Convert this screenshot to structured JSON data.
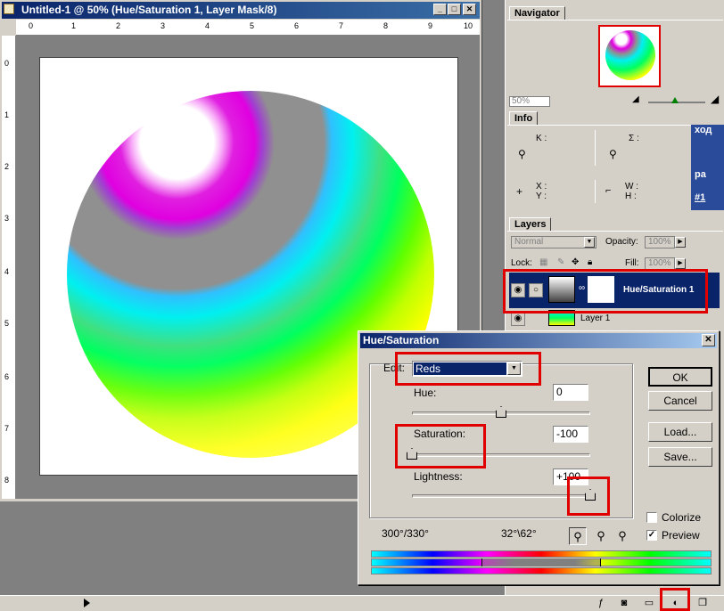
{
  "document": {
    "title": "Untitled-1 @ 50% (Hue/Saturation 1, Layer Mask/8)",
    "ruler_top_ticks": [
      "0",
      "1",
      "2",
      "3",
      "4",
      "5",
      "6",
      "7",
      "8",
      "9",
      "10"
    ],
    "ruler_left_ticks": [
      "0",
      "1",
      "2",
      "3",
      "4",
      "5",
      "6",
      "7",
      "8"
    ],
    "minimize": "_",
    "maximize": "□",
    "close": "✕"
  },
  "navigator": {
    "tab": "Navigator",
    "zoom": "50%"
  },
  "info": {
    "tab": "Info",
    "k_label": "K :",
    "sigma_label": "Σ :",
    "x_label": "X :",
    "y_label": "Y :",
    "w_label": "W :",
    "h_label": "H :",
    "blue_strip_top": "ход",
    "blue_strip_mid": "ра",
    "blue_strip_bot": "#1"
  },
  "layers": {
    "tab": "Layers",
    "blend_mode": "Normal",
    "opacity_label": "Opacity:",
    "opacity_value": "100%",
    "lock_label": "Lock:",
    "fill_label": "Fill:",
    "fill_value": "100%",
    "rows": [
      {
        "name": "Hue/Saturation 1"
      },
      {
        "name": "Layer 1"
      }
    ]
  },
  "dialog": {
    "title": "Hue/Saturation",
    "close": "✕",
    "edit_label": "Edit:",
    "edit_value": "Reds",
    "hue_label": "Hue:",
    "hue_value": "0",
    "saturation_label": "Saturation:",
    "saturation_value": "-100",
    "lightness_label": "Lightness:",
    "lightness_value": "+100",
    "hue_level": 0.5,
    "saturation_level": 0.0,
    "lightness_level": 1.0,
    "range_left": "300°/330°",
    "range_right": "32°\\62°",
    "buttons": {
      "ok": "OK",
      "cancel": "Cancel",
      "load": "Load...",
      "save": "Save..."
    },
    "colorize_label": "Colorize",
    "preview_label": "Preview",
    "colorize_checked": false,
    "preview_checked": true
  },
  "colors": {
    "title_bar": "#0a246a",
    "highlight_box": "#e00000",
    "panel_bg": "#d4d0c8"
  }
}
